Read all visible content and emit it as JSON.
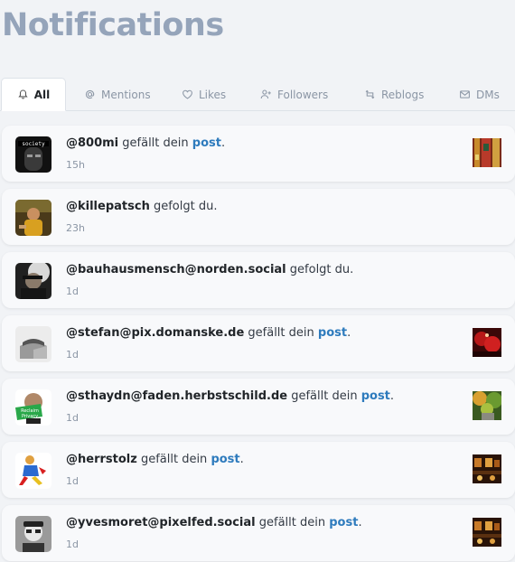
{
  "page_title": "Notifications",
  "tabs": [
    {
      "label": "All",
      "icon": "bell-icon",
      "active": true
    },
    {
      "label": "Mentions",
      "icon": "at-icon",
      "active": false
    },
    {
      "label": "Likes",
      "icon": "heart-icon",
      "active": false
    },
    {
      "label": "Followers",
      "icon": "user-plus-icon",
      "active": false
    },
    {
      "label": "Reblogs",
      "icon": "retweet-icon",
      "active": false
    },
    {
      "label": "DMs",
      "icon": "envelope-icon",
      "active": false
    }
  ],
  "notifications": [
    {
      "user": "@800mi",
      "action": " gefällt dein ",
      "link": "post",
      "end": ".",
      "time": "15h",
      "has_thumb": true
    },
    {
      "user": "@killepatsch",
      "action": " gefolgt du.",
      "link": "",
      "end": "",
      "time": "23h",
      "has_thumb": false
    },
    {
      "user": "@bauhausmensch@norden.social",
      "action": " gefolgt du.",
      "link": "",
      "end": "",
      "time": "1d",
      "has_thumb": false
    },
    {
      "user": "@stefan@pix.domanske.de",
      "action": " gefällt dein ",
      "link": "post",
      "end": ".",
      "time": "1d",
      "has_thumb": true
    },
    {
      "user": "@sthaydn@faden.herbstschild.de",
      "action": " gefällt dein ",
      "link": "post",
      "end": ".",
      "time": "1d",
      "has_thumb": true
    },
    {
      "user": "@herrstolz",
      "action": " gefällt dein ",
      "link": "post",
      "end": ".",
      "time": "1d",
      "has_thumb": true
    },
    {
      "user": "@yvesmoret@pixelfed.social",
      "action": " gefällt dein ",
      "link": "post",
      "end": ".",
      "time": "1d",
      "has_thumb": true
    }
  ],
  "avatar_texts": {
    "society": "society",
    "reclaim_top": "Reclaim",
    "reclaim_bottom": "Privacy"
  },
  "colors": {
    "title": "#95a4ba",
    "link": "#2e7bbd",
    "muted": "#8b96a5"
  }
}
